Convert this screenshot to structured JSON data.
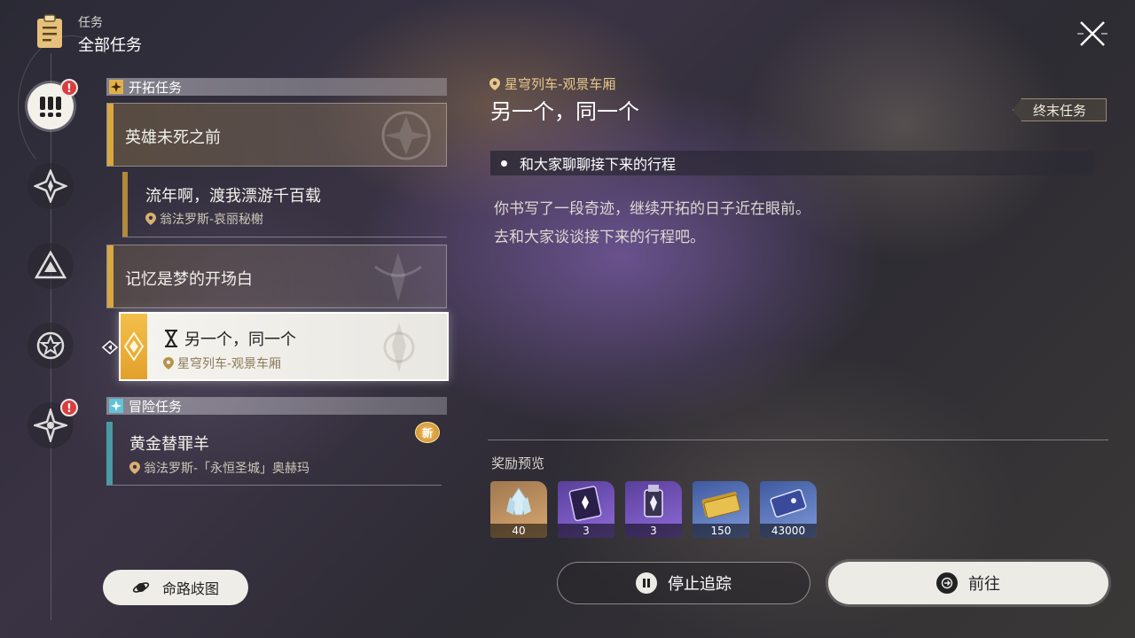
{
  "header": {
    "section_label": "任务",
    "title": "全部任务"
  },
  "rail": {
    "badge1": "!",
    "badge2": "!"
  },
  "sections": {
    "trailblaze": {
      "label": "开拓任务"
    },
    "adventure": {
      "label": "冒险任务"
    }
  },
  "quests": [
    {
      "title": "英雄未死之前"
    },
    {
      "title": "流年啊，渡我漂游千百载",
      "location": "翁法罗斯-哀丽秘榭"
    },
    {
      "title": "记忆是梦的开场白"
    },
    {
      "title": "另一个，同一个",
      "location": "星穹列车-观景车厢"
    },
    {
      "title": "黄金替罪羊",
      "location": "翁法罗斯-「永恒圣城」奥赫玛",
      "new_badge": "新"
    }
  ],
  "detail": {
    "location": "星穹列车-观景车厢",
    "title": "另一个，同一个",
    "tag": "终末任务",
    "objective": "和大家聊聊接下来的行程",
    "description": [
      "你书写了一段奇迹，继续开拓的日子近在眼前。",
      "去和大家谈谈接下来的行程吧。"
    ],
    "reward_label": "奖励预览",
    "rewards": [
      {
        "icon": "crystal-icon",
        "qty": "40"
      },
      {
        "icon": "purple-book-icon",
        "qty": "3"
      },
      {
        "icon": "purple-lantern-icon",
        "qty": "3"
      },
      {
        "icon": "gold-ticket-icon",
        "qty": "150"
      },
      {
        "icon": "credit-card-icon",
        "qty": "43000"
      }
    ]
  },
  "buttons": {
    "stop_tracking": "停止追踪",
    "go": "前往",
    "path_map": "命路歧图"
  },
  "colors": {
    "accent_gold": "#d9a640",
    "adventure_teal": "#4a9aa6",
    "badge_red": "#d93d3d"
  }
}
